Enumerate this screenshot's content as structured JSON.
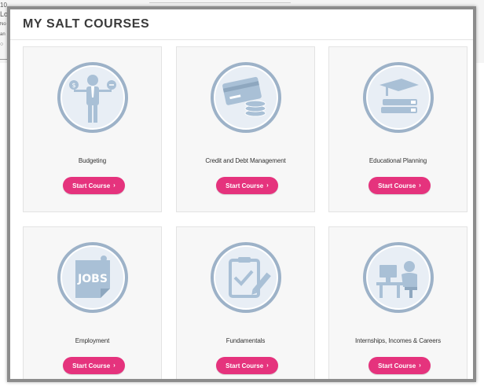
{
  "background": {
    "fragments": [
      "10",
      "Lo",
      "No",
      "an",
      "○"
    ]
  },
  "modal": {
    "title": "MY SALT COURSES"
  },
  "courses": [
    {
      "label": "Budgeting",
      "button": "Start Course",
      "icon": "person-balancing-money-icon"
    },
    {
      "label": "Credit and Debt Management",
      "button": "Start Course",
      "icon": "credit-card-and-coins-icon"
    },
    {
      "label": "Educational Planning",
      "button": "Start Course",
      "icon": "graduation-cap-books-icon"
    },
    {
      "label": "Employment",
      "button": "Start Course",
      "icon": "jobs-document-icon"
    },
    {
      "label": "Fundamentals",
      "button": "Start Course",
      "icon": "clipboard-checklist-icon"
    },
    {
      "label": "Internships, Incomes & Careers",
      "button": "Start Course",
      "icon": "person-at-desk-icon"
    }
  ],
  "colors": {
    "accent": "#e5337d",
    "icon_fill": "#a9c0d6",
    "icon_ring": "#9db2c8"
  }
}
